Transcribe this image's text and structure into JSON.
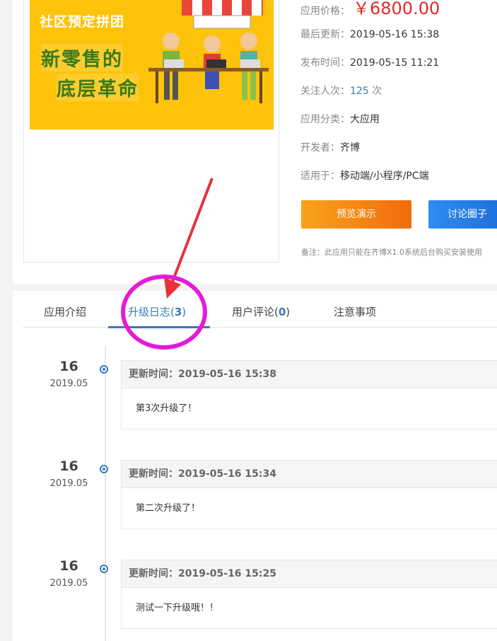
{
  "banner": {
    "slogan": "社区预定拼团",
    "headline_line1": "新零售的",
    "headline_line2": "底层革命"
  },
  "app_info": {
    "price_label": "应用价格：",
    "price_value": "￥6800.00",
    "updated_label": "最后更新：",
    "updated_value": "2019-05-16 15:38",
    "published_label": "发布时间：",
    "published_value": "2019-05-15 11:21",
    "followers_label": "关注人次：",
    "followers_count": "125",
    "followers_unit": " 次",
    "category_label": "应用分类：",
    "category_value": "大应用",
    "developer_label": "开发者：",
    "developer_value": "齐博",
    "platform_label": "适用于：",
    "platform_value": "移动端/小程序/PC端"
  },
  "buttons": {
    "preview": "预览演示",
    "discuss": "讨论圈子"
  },
  "note": "备注：此应用只能在齐博X1.0系统后台购买安装使用",
  "tabs": [
    {
      "label": "应用介绍",
      "count": null
    },
    {
      "label": "升级日志(",
      "count": "3",
      "close": ")"
    },
    {
      "label": "用户评论(",
      "count": "0",
      "close": ")"
    },
    {
      "label": "注意事项",
      "count": null
    }
  ],
  "timeline": [
    {
      "day": "16",
      "year_month": "2019.05",
      "header": "更新时间：2019-05-16 15:38",
      "content": "第3次升级了！"
    },
    {
      "day": "16",
      "year_month": "2019.05",
      "header": "更新时间：2019-05-16 15:34",
      "content": "第二次升级了！"
    },
    {
      "day": "16",
      "year_month": "2019.05",
      "header": "更新时间：2019-05-16 15:25",
      "content": "测试一下升级哦！！"
    }
  ],
  "colors": {
    "accent_blue": "#3a7ab8",
    "price_red": "#e02b2b",
    "banner_yellow": "#fdc30a",
    "annotation_magenta": "#e31bd8",
    "annotation_red": "#e8323a"
  }
}
